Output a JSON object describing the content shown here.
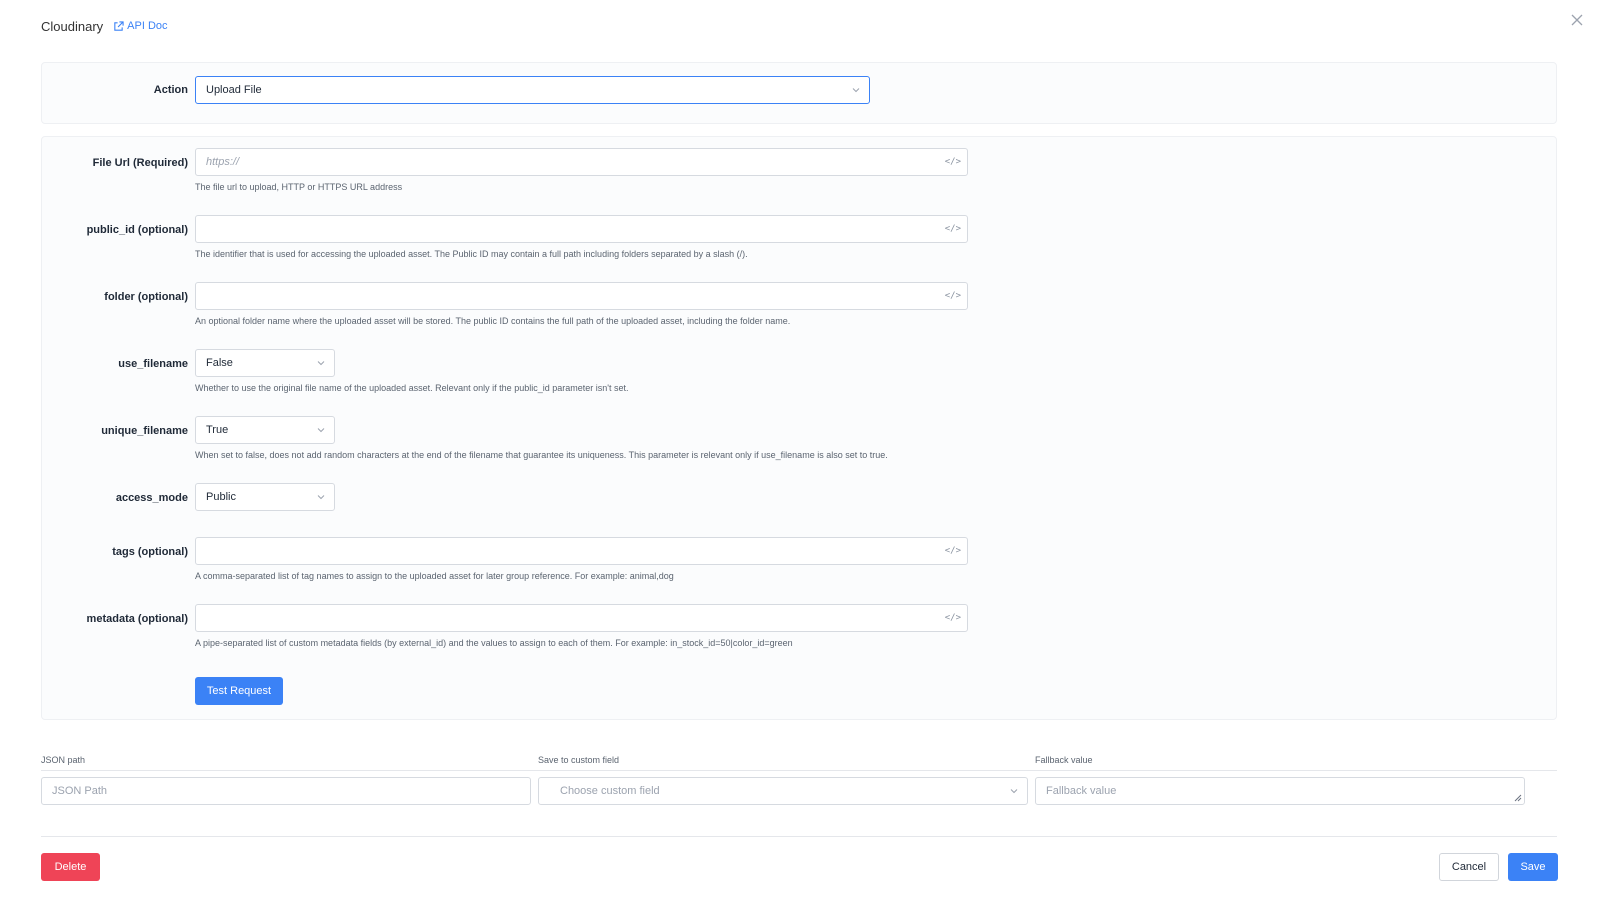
{
  "header": {
    "title": "Cloudinary",
    "api_doc_label": "API Doc"
  },
  "action": {
    "label": "Action",
    "value": "Upload File"
  },
  "fields": [
    {
      "label": "File Url (Required)",
      "placeholder": "https://",
      "help": "The file url to upload, HTTP or HTTPS URL address"
    },
    {
      "label": "public_id (optional)",
      "placeholder": "",
      "help": "The identifier that is used for accessing the uploaded asset. The Public ID may contain a full path including folders separated by a slash (/)."
    },
    {
      "label": "folder (optional)",
      "placeholder": "",
      "help": "An optional folder name where the uploaded asset will be stored. The public ID contains the full path of the uploaded asset, including the folder name."
    },
    {
      "label": "use_filename",
      "value": "False",
      "help": "Whether to use the original file name of the uploaded asset. Relevant only if the public_id parameter isn't set."
    },
    {
      "label": "unique_filename",
      "value": "True",
      "help": "When set to false, does not add random characters at the end of the filename that guarantee its uniqueness. This parameter is relevant only if use_filename is also set to true."
    },
    {
      "label": "access_mode",
      "value": "Public",
      "help": ""
    },
    {
      "label": "tags (optional)",
      "placeholder": "",
      "help": "A comma-separated list of tag names to assign to the uploaded asset for later group reference. For example: animal,dog"
    },
    {
      "label": "metadata (optional)",
      "placeholder": "",
      "help": "A pipe-separated list of custom metadata fields (by external_id) and the values to assign to each of them. For example: in_stock_id=50|color_id=green"
    }
  ],
  "code_icon": "</>",
  "test_request_label": "Test Request",
  "mapping": {
    "json_path_label": "JSON path",
    "json_path_placeholder": "JSON Path",
    "custom_field_label": "Save to custom field",
    "custom_field_placeholder": "Choose custom field",
    "fallback_label": "Fallback value",
    "fallback_placeholder": "Fallback value"
  },
  "footer": {
    "delete_label": "Delete",
    "cancel_label": "Cancel",
    "save_label": "Save"
  },
  "colors": {
    "primary": "#3b82f6",
    "danger": "#ef4457"
  }
}
